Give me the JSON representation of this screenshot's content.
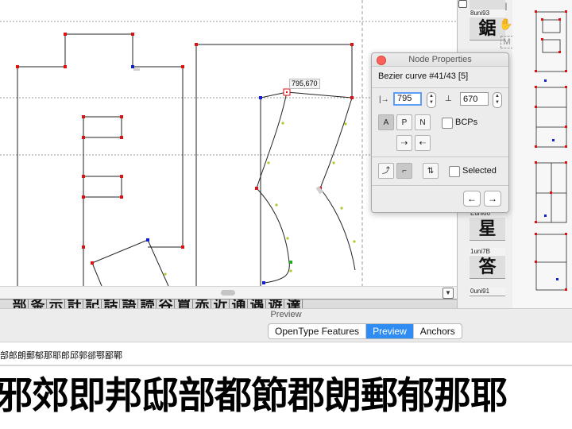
{
  "canvas": {
    "coord_tooltip": "795,670"
  },
  "node_properties": {
    "title": "Node Properties",
    "heading": "Bezier curve #41/43 [5]",
    "x_value": "795",
    "y_value": "670",
    "bcps_label": "BCPs",
    "selected_label": "Selected",
    "node_type_buttons": [
      "A",
      "P",
      "N"
    ],
    "prev_label": "←",
    "next_label": "→"
  },
  "glyph_list": [
    {
      "label": "8uni93",
      "char": "鋸"
    },
    {
      "label": "Euni66",
      "char": "星"
    },
    {
      "label": "1uni7B",
      "char": "答"
    },
    {
      "label": "0uni91",
      "char": ""
    }
  ],
  "glyph_strip": [
    "部",
    "条",
    "示",
    "計",
    "記",
    "話",
    "語",
    "読",
    "谷",
    "買",
    "赤",
    "近",
    "通",
    "遇",
    "遊",
    "達"
  ],
  "preview": {
    "header": "Preview",
    "tabs": [
      "OpenType Features",
      "Preview",
      "Anchors"
    ],
    "active_tab": "Preview",
    "sample_line": "部郎朗郵郁那耶郎邱郭郤鄂鄙鄲",
    "big_text": "邪郊即邦邸部都節郡朗郵郁那耶"
  },
  "colors": {
    "accent": "#2f8cf3",
    "node_red": "#dd1111",
    "node_blue": "#1122cc",
    "close_red": "#fc605b"
  },
  "icons": {
    "text_tool": "text-cursor-icon",
    "hand_tool": "hand-icon",
    "measure_tool": "measure-icon"
  }
}
